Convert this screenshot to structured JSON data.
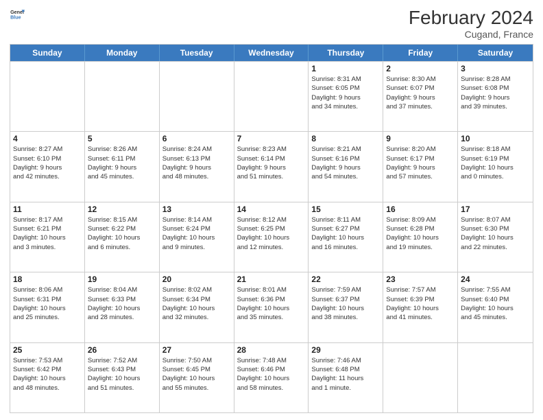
{
  "header": {
    "logo_line1": "General",
    "logo_line2": "Blue",
    "month_year": "February 2024",
    "location": "Cugand, France"
  },
  "weekdays": [
    "Sunday",
    "Monday",
    "Tuesday",
    "Wednesday",
    "Thursday",
    "Friday",
    "Saturday"
  ],
  "weeks": [
    [
      {
        "day": "",
        "info": ""
      },
      {
        "day": "",
        "info": ""
      },
      {
        "day": "",
        "info": ""
      },
      {
        "day": "",
        "info": ""
      },
      {
        "day": "1",
        "info": "Sunrise: 8:31 AM\nSunset: 6:05 PM\nDaylight: 9 hours\nand 34 minutes."
      },
      {
        "day": "2",
        "info": "Sunrise: 8:30 AM\nSunset: 6:07 PM\nDaylight: 9 hours\nand 37 minutes."
      },
      {
        "day": "3",
        "info": "Sunrise: 8:28 AM\nSunset: 6:08 PM\nDaylight: 9 hours\nand 39 minutes."
      }
    ],
    [
      {
        "day": "4",
        "info": "Sunrise: 8:27 AM\nSunset: 6:10 PM\nDaylight: 9 hours\nand 42 minutes."
      },
      {
        "day": "5",
        "info": "Sunrise: 8:26 AM\nSunset: 6:11 PM\nDaylight: 9 hours\nand 45 minutes."
      },
      {
        "day": "6",
        "info": "Sunrise: 8:24 AM\nSunset: 6:13 PM\nDaylight: 9 hours\nand 48 minutes."
      },
      {
        "day": "7",
        "info": "Sunrise: 8:23 AM\nSunset: 6:14 PM\nDaylight: 9 hours\nand 51 minutes."
      },
      {
        "day": "8",
        "info": "Sunrise: 8:21 AM\nSunset: 6:16 PM\nDaylight: 9 hours\nand 54 minutes."
      },
      {
        "day": "9",
        "info": "Sunrise: 8:20 AM\nSunset: 6:17 PM\nDaylight: 9 hours\nand 57 minutes."
      },
      {
        "day": "10",
        "info": "Sunrise: 8:18 AM\nSunset: 6:19 PM\nDaylight: 10 hours\nand 0 minutes."
      }
    ],
    [
      {
        "day": "11",
        "info": "Sunrise: 8:17 AM\nSunset: 6:21 PM\nDaylight: 10 hours\nand 3 minutes."
      },
      {
        "day": "12",
        "info": "Sunrise: 8:15 AM\nSunset: 6:22 PM\nDaylight: 10 hours\nand 6 minutes."
      },
      {
        "day": "13",
        "info": "Sunrise: 8:14 AM\nSunset: 6:24 PM\nDaylight: 10 hours\nand 9 minutes."
      },
      {
        "day": "14",
        "info": "Sunrise: 8:12 AM\nSunset: 6:25 PM\nDaylight: 10 hours\nand 12 minutes."
      },
      {
        "day": "15",
        "info": "Sunrise: 8:11 AM\nSunset: 6:27 PM\nDaylight: 10 hours\nand 16 minutes."
      },
      {
        "day": "16",
        "info": "Sunrise: 8:09 AM\nSunset: 6:28 PM\nDaylight: 10 hours\nand 19 minutes."
      },
      {
        "day": "17",
        "info": "Sunrise: 8:07 AM\nSunset: 6:30 PM\nDaylight: 10 hours\nand 22 minutes."
      }
    ],
    [
      {
        "day": "18",
        "info": "Sunrise: 8:06 AM\nSunset: 6:31 PM\nDaylight: 10 hours\nand 25 minutes."
      },
      {
        "day": "19",
        "info": "Sunrise: 8:04 AM\nSunset: 6:33 PM\nDaylight: 10 hours\nand 28 minutes."
      },
      {
        "day": "20",
        "info": "Sunrise: 8:02 AM\nSunset: 6:34 PM\nDaylight: 10 hours\nand 32 minutes."
      },
      {
        "day": "21",
        "info": "Sunrise: 8:01 AM\nSunset: 6:36 PM\nDaylight: 10 hours\nand 35 minutes."
      },
      {
        "day": "22",
        "info": "Sunrise: 7:59 AM\nSunset: 6:37 PM\nDaylight: 10 hours\nand 38 minutes."
      },
      {
        "day": "23",
        "info": "Sunrise: 7:57 AM\nSunset: 6:39 PM\nDaylight: 10 hours\nand 41 minutes."
      },
      {
        "day": "24",
        "info": "Sunrise: 7:55 AM\nSunset: 6:40 PM\nDaylight: 10 hours\nand 45 minutes."
      }
    ],
    [
      {
        "day": "25",
        "info": "Sunrise: 7:53 AM\nSunset: 6:42 PM\nDaylight: 10 hours\nand 48 minutes."
      },
      {
        "day": "26",
        "info": "Sunrise: 7:52 AM\nSunset: 6:43 PM\nDaylight: 10 hours\nand 51 minutes."
      },
      {
        "day": "27",
        "info": "Sunrise: 7:50 AM\nSunset: 6:45 PM\nDaylight: 10 hours\nand 55 minutes."
      },
      {
        "day": "28",
        "info": "Sunrise: 7:48 AM\nSunset: 6:46 PM\nDaylight: 10 hours\nand 58 minutes."
      },
      {
        "day": "29",
        "info": "Sunrise: 7:46 AM\nSunset: 6:48 PM\nDaylight: 11 hours\nand 1 minute."
      },
      {
        "day": "",
        "info": ""
      },
      {
        "day": "",
        "info": ""
      }
    ]
  ]
}
